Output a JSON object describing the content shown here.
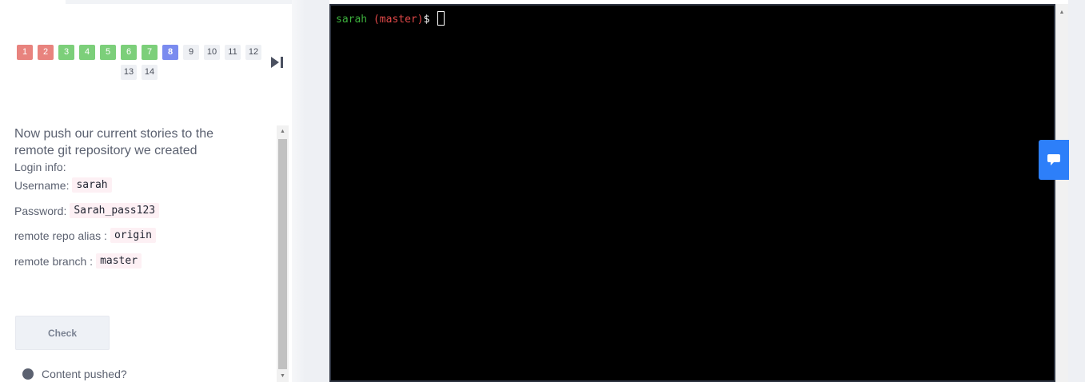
{
  "pager": {
    "pages": [
      {
        "label": "1",
        "state": "failed"
      },
      {
        "label": "2",
        "state": "failed"
      },
      {
        "label": "3",
        "state": "passed"
      },
      {
        "label": "4",
        "state": "passed"
      },
      {
        "label": "5",
        "state": "passed"
      },
      {
        "label": "6",
        "state": "passed"
      },
      {
        "label": "7",
        "state": "passed"
      },
      {
        "label": "8",
        "state": "current"
      },
      {
        "label": "9",
        "state": "pending"
      },
      {
        "label": "10",
        "state": "pending"
      },
      {
        "label": "11",
        "state": "pending"
      },
      {
        "label": "12",
        "state": "pending"
      },
      {
        "label": "13",
        "state": "pending"
      },
      {
        "label": "14",
        "state": "pending"
      }
    ],
    "next_icon": "skip-to-end-icon"
  },
  "task": {
    "title": "Now push our current stories to the remote git repository we created",
    "login_info_label": "Login info:",
    "username_label": "Username:",
    "username_value": "sarah",
    "password_label": "Password:",
    "password_value": "Sarah_pass123",
    "alias_label": "remote repo alias :",
    "alias_value": "origin",
    "branch_label": "remote branch :",
    "branch_value": "master",
    "check_label": "Check",
    "result_label": "Content pushed?"
  },
  "terminal": {
    "user": "sarah",
    "branch": " (master)",
    "prompt_symbol": "$ "
  },
  "feedback": {
    "icon": "chat-bubble-icon"
  },
  "colors": {
    "failed": "#e8837e",
    "passed": "#7ccf7a",
    "current": "#7a8bef",
    "terminal_bg": "#000000",
    "prompt_user": "#3cae3c",
    "prompt_branch": "#e04848",
    "feedback_bg": "#2d7ff9"
  }
}
